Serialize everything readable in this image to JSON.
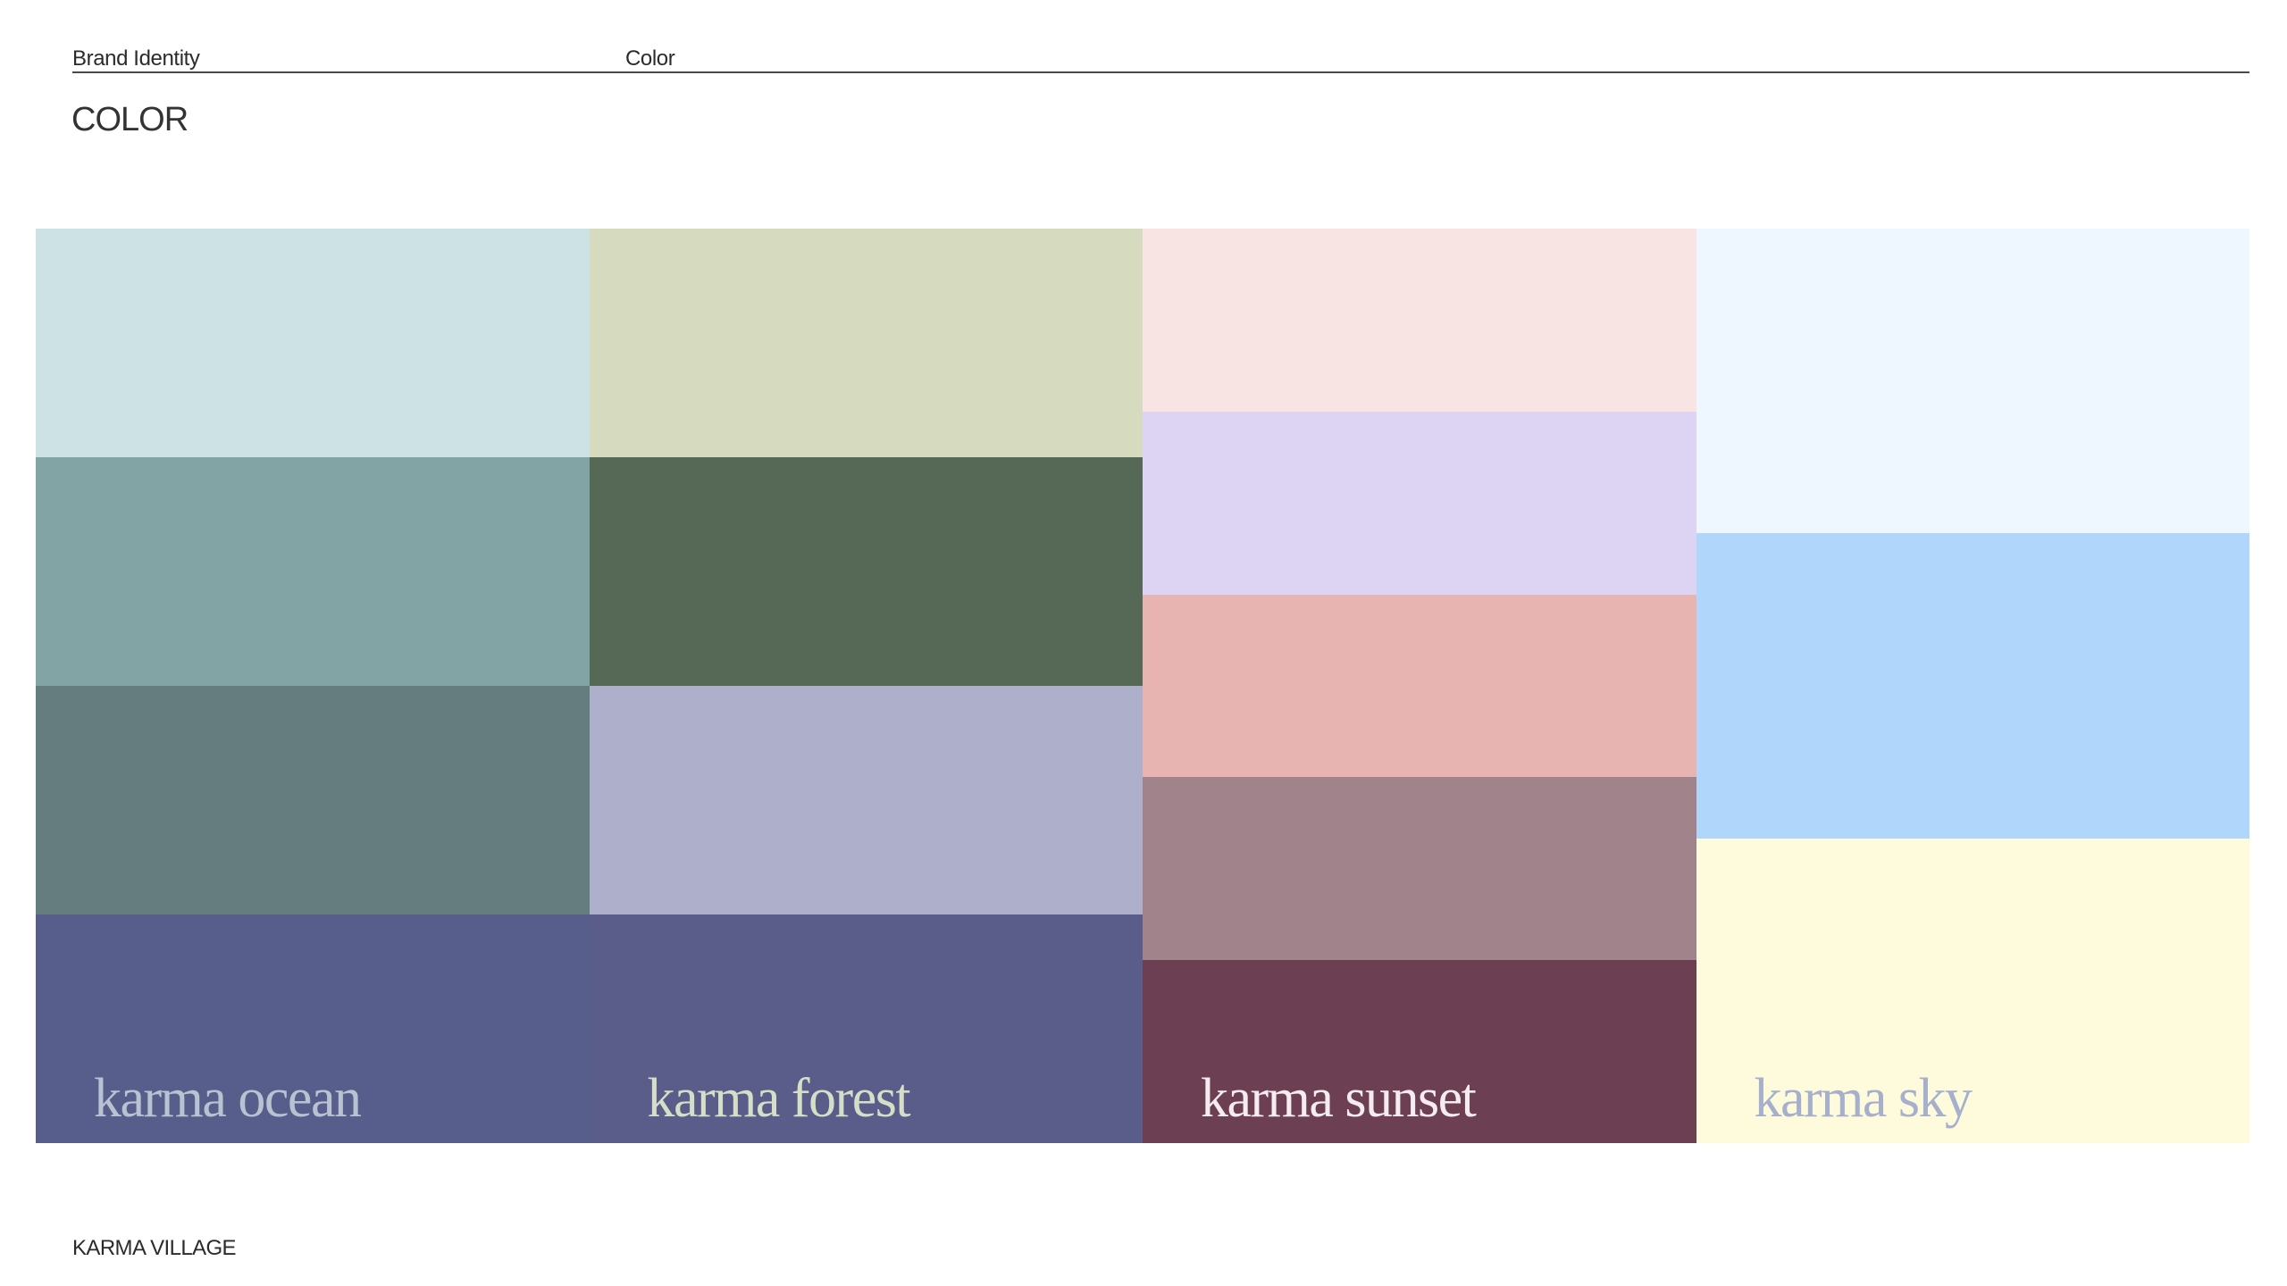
{
  "header": {
    "section": "Brand Identity",
    "subsection": "Color"
  },
  "page": {
    "title": "COLOR"
  },
  "palette": {
    "families": [
      {
        "name": "karma ocean",
        "label_color": "#B9C2D0",
        "swatches": [
          "#CCE2E4",
          "#83A4A5",
          "#667D80",
          "#585E8C"
        ]
      },
      {
        "name": "karma forest",
        "label_color": "#D5DEC6",
        "swatches": [
          "#D6DABF",
          "#556956",
          "#AEB0CB",
          "#5A5D89"
        ]
      },
      {
        "name": "karma sunset",
        "label_color": "#F4ECEF",
        "swatches": [
          "#F8E4E3",
          "#DDD3F2",
          "#E7B4B1",
          "#A1838C",
          "#6D3F52"
        ]
      },
      {
        "name": "karma sky",
        "label_color": "#A6AFCC",
        "swatches": [
          "#EEF7FF",
          "#B0D6FC",
          "#FEFBDD"
        ]
      }
    ]
  },
  "footer": {
    "brand": "KARMA VILLAGE"
  }
}
